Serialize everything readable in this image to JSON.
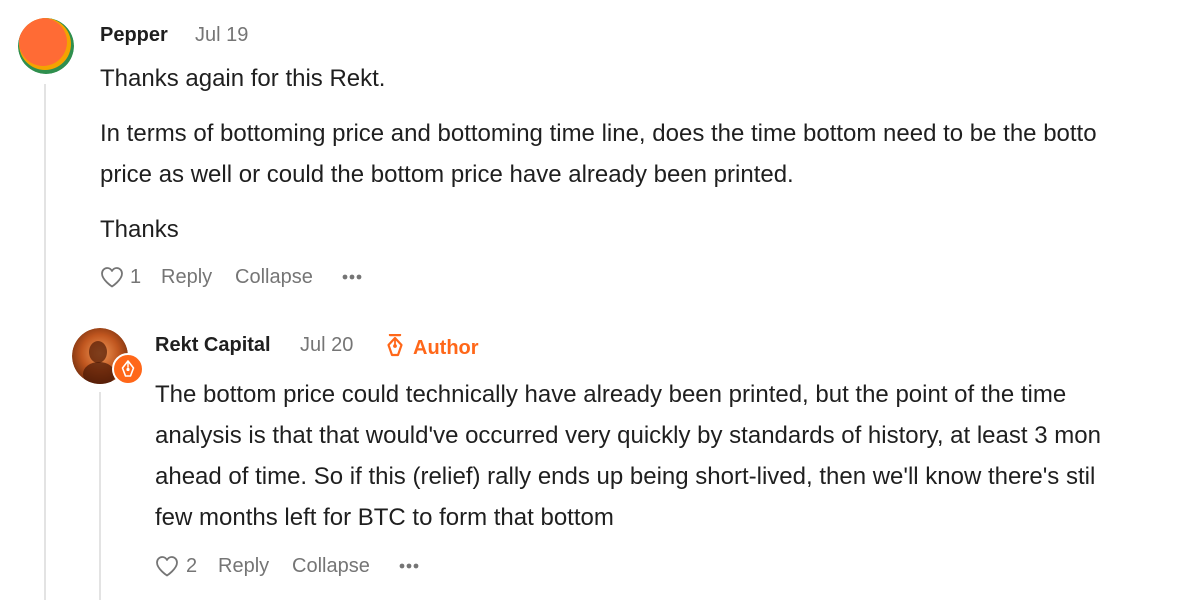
{
  "comments": [
    {
      "author": "Pepper",
      "date": "Jul 19",
      "paragraphs": [
        "Thanks again for this Rekt.",
        "In terms of bottoming price and bottoming time line, does the time bottom need to be the botto",
        "price as well or could the bottom price have already been printed.",
        "Thanks"
      ],
      "like_count": "1",
      "reply_label": "Reply",
      "collapse_label": "Collapse",
      "more_icon": "ellipsis-icon",
      "like_icon": "heart-icon",
      "avatar_colors": [
        "#ff6b35",
        "#f4a300",
        "#2f8f4e"
      ]
    },
    {
      "author": "Rekt Capital",
      "date": "Jul 20",
      "badge_label": "Author",
      "badge_icon": "pen-nib-icon",
      "paragraphs": [
        "The bottom price could technically have already been printed, but the point of the time",
        "analysis is that that would've occurred very quickly by standards of history, at least 3 mon",
        "ahead of time. So if this (relief) rally ends up being short-lived, then we'll know there's stil",
        "few months left for BTC to form that bottom"
      ],
      "like_count": "2",
      "reply_label": "Reply",
      "collapse_label": "Collapse",
      "more_icon": "ellipsis-icon",
      "like_icon": "heart-icon",
      "accent_color": "#ff6719"
    }
  ]
}
